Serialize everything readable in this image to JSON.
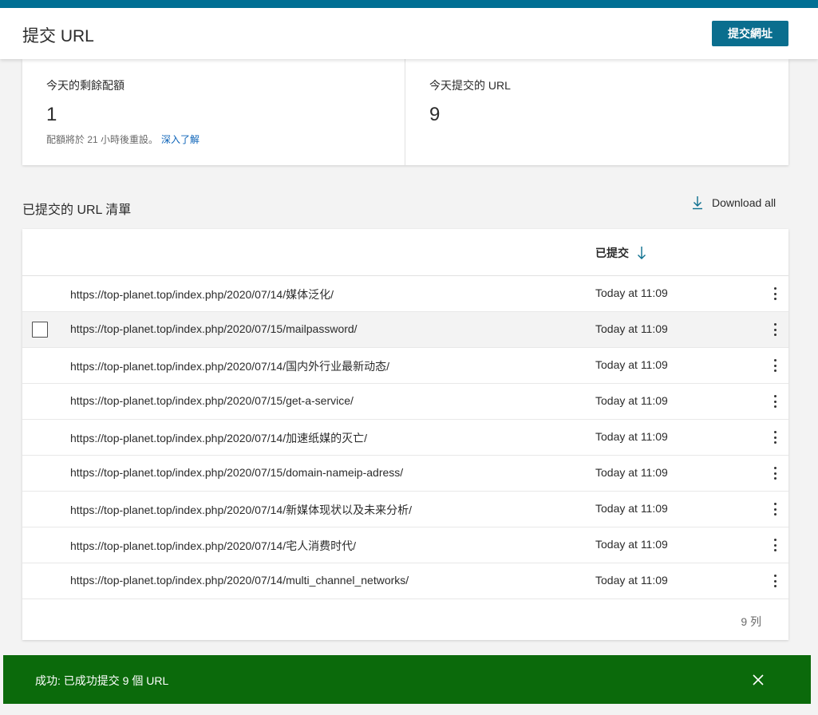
{
  "header": {
    "title": "提交 URL",
    "submit_button": "提交網址"
  },
  "stats": {
    "quota_label": "今天的剩餘配額",
    "quota_value": "1",
    "quota_note": "配額將於 21 小時後重設。",
    "quota_link": "深入了解",
    "submitted_label": "今天提交的 URL",
    "submitted_value": "9"
  },
  "list": {
    "title": "已提交的 URL 清單",
    "download_label": "Download all",
    "column_submitted": "已提交",
    "rows": [
      {
        "url": "https://top-planet.top/index.php/2020/07/14/媒体泛化/",
        "time": "Today at 11:09"
      },
      {
        "url": "https://top-planet.top/index.php/2020/07/15/mailpassword/",
        "time": "Today at 11:09"
      },
      {
        "url": "https://top-planet.top/index.php/2020/07/14/国内外行业最新动态/",
        "time": "Today at 11:09"
      },
      {
        "url": "https://top-planet.top/index.php/2020/07/15/get-a-service/",
        "time": "Today at 11:09"
      },
      {
        "url": "https://top-planet.top/index.php/2020/07/14/加速纸媒的灭亡/",
        "time": "Today at 11:09"
      },
      {
        "url": "https://top-planet.top/index.php/2020/07/15/domain-nameip-adress/",
        "time": "Today at 11:09"
      },
      {
        "url": "https://top-planet.top/index.php/2020/07/14/新媒体现状以及未来分析/",
        "time": "Today at 11:09"
      },
      {
        "url": "https://top-planet.top/index.php/2020/07/14/宅人消费时代/",
        "time": "Today at 11:09"
      },
      {
        "url": "https://top-planet.top/index.php/2020/07/14/multi_channel_networks/",
        "time": "Today at 11:09"
      }
    ],
    "row_count": "9 列"
  },
  "toast": {
    "message": "成功: 已成功提交 9 個 URL"
  },
  "colors": {
    "accent": "#0a6e8e",
    "toast_bg": "#0b6a0b",
    "link": "#0c63b8"
  }
}
